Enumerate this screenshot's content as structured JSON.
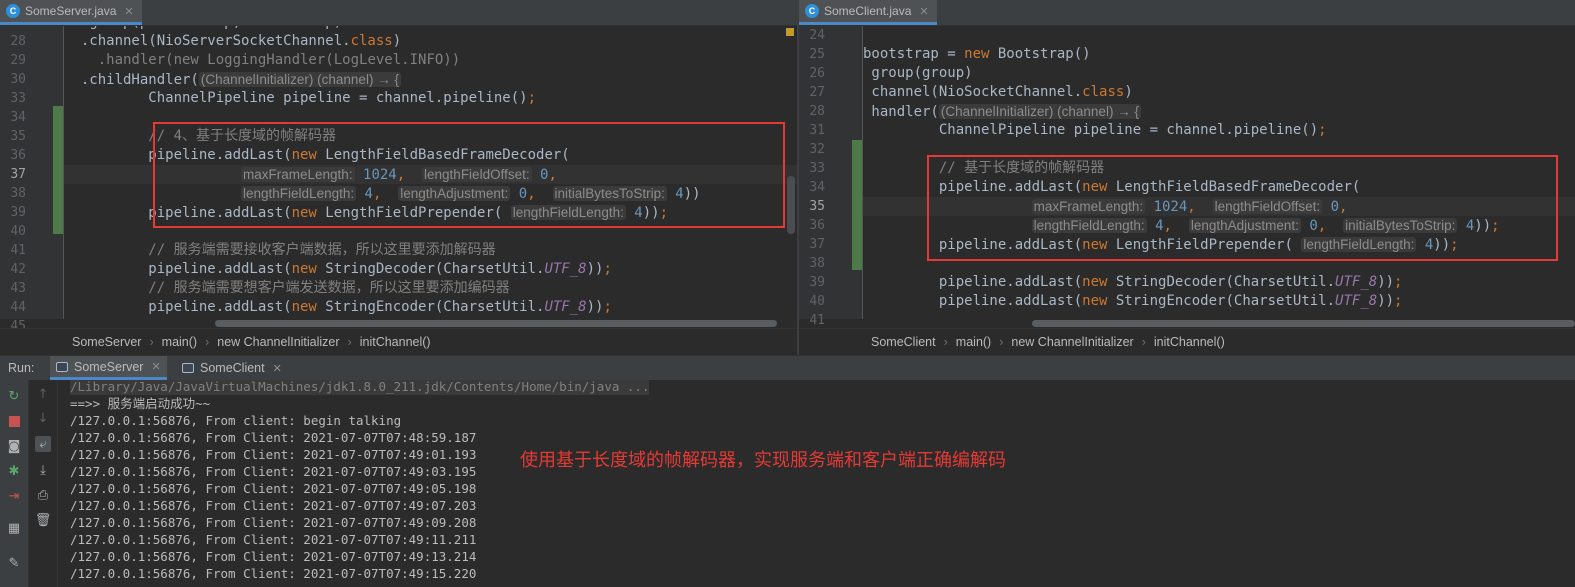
{
  "left_editor": {
    "tab": {
      "icon": "C",
      "label": "SomeServer.java"
    },
    "lines": [
      {
        "n": "28",
        "html": "  .channel(NioServerSocketChannel.<span class='kw'>class</span>)"
      },
      {
        "n": "29",
        "html": "    <span class='cmt'>.handler(new LoggingHandler(LogLevel.INFO))</span>"
      },
      {
        "n": "30",
        "html": "  .childHandler(<span class='hint'>(ChannelInitializer) (channel) → {</span>"
      },
      {
        "n": "33",
        "html": "          ChannelPipeline pipeline = channel.pipeline()<span class='kw'>;</span>"
      },
      {
        "n": "34",
        "html": ""
      },
      {
        "n": "35",
        "html": "          <span class='cmt'>// 4、基于长度域的帧解码器</span>"
      },
      {
        "n": "36",
        "html": "          pipeline.addLast(<span class='kw'>new</span> LengthFieldBasedFrameDecoder("
      },
      {
        "n": "37",
        "html": "                     <span class='hint'>maxFrameLength:</span> <span class='num'>1024</span><span class='kw'>,</span>  <span class='hint'>lengthFieldOffset:</span> <span class='num'>0</span><span class='kw'>,</span>"
      },
      {
        "n": "38",
        "html": "                     <span class='hint'>lengthFieldLength:</span> <span class='num'>4</span><span class='kw'>,</span>  <span class='hint'>lengthAdjustment:</span> <span class='num'>0</span><span class='kw'>,</span>  <span class='hint'>initialBytesToStrip:</span> <span class='num'>4</span>))"
      },
      {
        "n": "39",
        "html": "          pipeline.addLast(<span class='kw'>new</span> LengthFieldPrepender( <span class='hint'>lengthFieldLength:</span> <span class='num'>4</span>))<span class='kw'>;</span>"
      },
      {
        "n": "40",
        "html": ""
      },
      {
        "n": "41",
        "html": "          <span class='cmt'>// 服务端需要接收客户端数据，所以这里要添加解码器</span>"
      },
      {
        "n": "42",
        "html": "          pipeline.addLast(<span class='kw'>new</span> StringDecoder(CharsetUtil.<span class='const'>UTF_8</span>))<span class='kw'>;</span>"
      },
      {
        "n": "43",
        "html": "          <span class='cmt'>// 服务端需要想客户端发送数据，所以这里要添加编码器</span>"
      },
      {
        "n": "44",
        "html": "          pipeline.addLast(<span class='kw'>new</span> StringEncoder(CharsetUtil.<span class='const'>UTF_8</span>))<span class='kw'>;</span>"
      },
      {
        "n": "45",
        "html": ""
      }
    ],
    "top_partial": "  .group(parentGroup, childGroup)",
    "breadcrumb": [
      "SomeServer",
      "main()",
      "new ChannelInitializer",
      "initChannel()"
    ]
  },
  "right_editor": {
    "tab": {
      "icon": "C",
      "label": "SomeClient.java"
    },
    "lines": [
      {
        "n": "24",
        "html": ""
      },
      {
        "n": "25",
        "html": "bootstrap = <span class='kw'>new</span> Bootstrap()"
      },
      {
        "n": "26",
        "html": " group(group)"
      },
      {
        "n": "27",
        "html": " channel(NioSocketChannel.<span class='kw'>class</span>)"
      },
      {
        "n": "28",
        "html": " handler(<span class='hint'>(ChannelInitializer) (channel) → {</span>"
      },
      {
        "n": "31",
        "html": "         ChannelPipeline pipeline = channel.pipeline()<span class='kw'>;</span>"
      },
      {
        "n": "32",
        "html": ""
      },
      {
        "n": "33",
        "html": "         <span class='cmt'>// 基于长度域的帧解码器</span>"
      },
      {
        "n": "34",
        "html": "         pipeline.addLast(<span class='kw'>new</span> LengthFieldBasedFrameDecoder("
      },
      {
        "n": "35",
        "html": "                    <span class='hint'>maxFrameLength:</span> <span class='num'>1024</span><span class='kw'>,</span>  <span class='hint'>lengthFieldOffset:</span> <span class='num'>0</span><span class='kw'>,</span>"
      },
      {
        "n": "36",
        "html": "                    <span class='hint'>lengthFieldLength:</span> <span class='num'>4</span><span class='kw'>,</span>  <span class='hint'>lengthAdjustment:</span> <span class='num'>0</span><span class='kw'>,</span>  <span class='hint'>initialBytesToStrip:</span> <span class='num'>4</span>))<span class='kw'>;</span>"
      },
      {
        "n": "37",
        "html": "         pipeline.addLast(<span class='kw'>new</span> LengthFieldPrepender( <span class='hint'>lengthFieldLength:</span> <span class='num'>4</span>))<span class='kw'>;</span>"
      },
      {
        "n": "38",
        "html": ""
      },
      {
        "n": "39",
        "html": "         pipeline.addLast(<span class='kw'>new</span> StringDecoder(CharsetUtil.<span class='const'>UTF_8</span>))<span class='kw'>;</span>"
      },
      {
        "n": "40",
        "html": "         pipeline.addLast(<span class='kw'>new</span> StringEncoder(CharsetUtil.<span class='const'>UTF_8</span>))<span class='kw'>;</span>"
      },
      {
        "n": "41",
        "html": ""
      }
    ],
    "breadcrumb": [
      "SomeClient",
      "main()",
      "new ChannelInitializer",
      "initChannel()"
    ]
  },
  "run": {
    "label": "Run:",
    "tabs": [
      "SomeServer",
      "SomeClient"
    ]
  },
  "console": {
    "lines": [
      "/Library/Java/JavaVirtualMachines/jdk1.8.0_211.jdk/Contents/Home/bin/java ...",
      "==>> 服务端启动成功~~",
      "/127.0.0.1:56876, From client: begin talking",
      "/127.0.0.1:56876, From Client: 2021-07-07T07:48:59.187",
      "/127.0.0.1:56876, From Client: 2021-07-07T07:49:01.193",
      "/127.0.0.1:56876, From Client: 2021-07-07T07:49:03.195",
      "/127.0.0.1:56876, From Client: 2021-07-07T07:49:05.198",
      "/127.0.0.1:56876, From Client: 2021-07-07T07:49:07.203",
      "/127.0.0.1:56876, From Client: 2021-07-07T07:49:09.208",
      "/127.0.0.1:56876, From Client: 2021-07-07T07:49:11.211",
      "/127.0.0.1:56876, From Client: 2021-07-07T07:49:13.214",
      "/127.0.0.1:56876, From Client: 2021-07-07T07:49:15.220"
    ],
    "annotation": "使用基于长度域的帧解码器，实现服务端和客户端正确编解码"
  },
  "colors": {
    "annotation_red": "#e53935",
    "keyword": "#cc7832",
    "tab_accent": "#4a88c7"
  }
}
